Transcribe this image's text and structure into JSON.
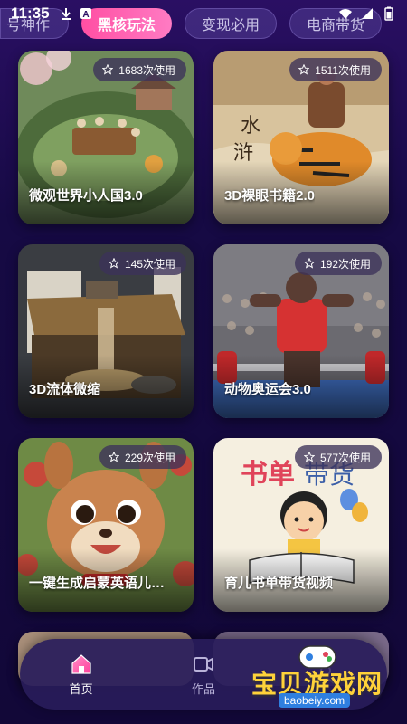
{
  "status": {
    "time": "11:35"
  },
  "tabs": [
    {
      "label": "号神作",
      "active": false
    },
    {
      "label": "黑核玩法",
      "active": true
    },
    {
      "label": "变现必用",
      "active": false
    },
    {
      "label": "电商带货",
      "active": false
    }
  ],
  "cards": [
    {
      "title": "微观世界小人国3.0",
      "uses": "1683次使用",
      "theme": "miniature-world"
    },
    {
      "title": "3D裸眼书籍2.0",
      "uses": "1511次使用",
      "theme": "tiger-book"
    },
    {
      "title": "3D流体微缩",
      "uses": "145次使用",
      "theme": "fluid-mini"
    },
    {
      "title": "动物奥运会3.0",
      "uses": "192次使用",
      "theme": "weightlifter"
    },
    {
      "title": "一键生成启蒙英语儿…",
      "uses": "229次使用",
      "theme": "squirrel"
    },
    {
      "title": "育儿书单带货视频",
      "uses": "577次使用",
      "theme": "book-kid"
    }
  ],
  "nav": {
    "home": "首页",
    "works": "作品"
  },
  "watermark": {
    "text": "宝贝游戏网",
    "url": "baobeiy.com"
  },
  "colors": {
    "accent": "#ff4fa3",
    "badge_bg": "#3c325a",
    "bg_top": "#2a0f63",
    "bg_bottom": "#120838"
  }
}
